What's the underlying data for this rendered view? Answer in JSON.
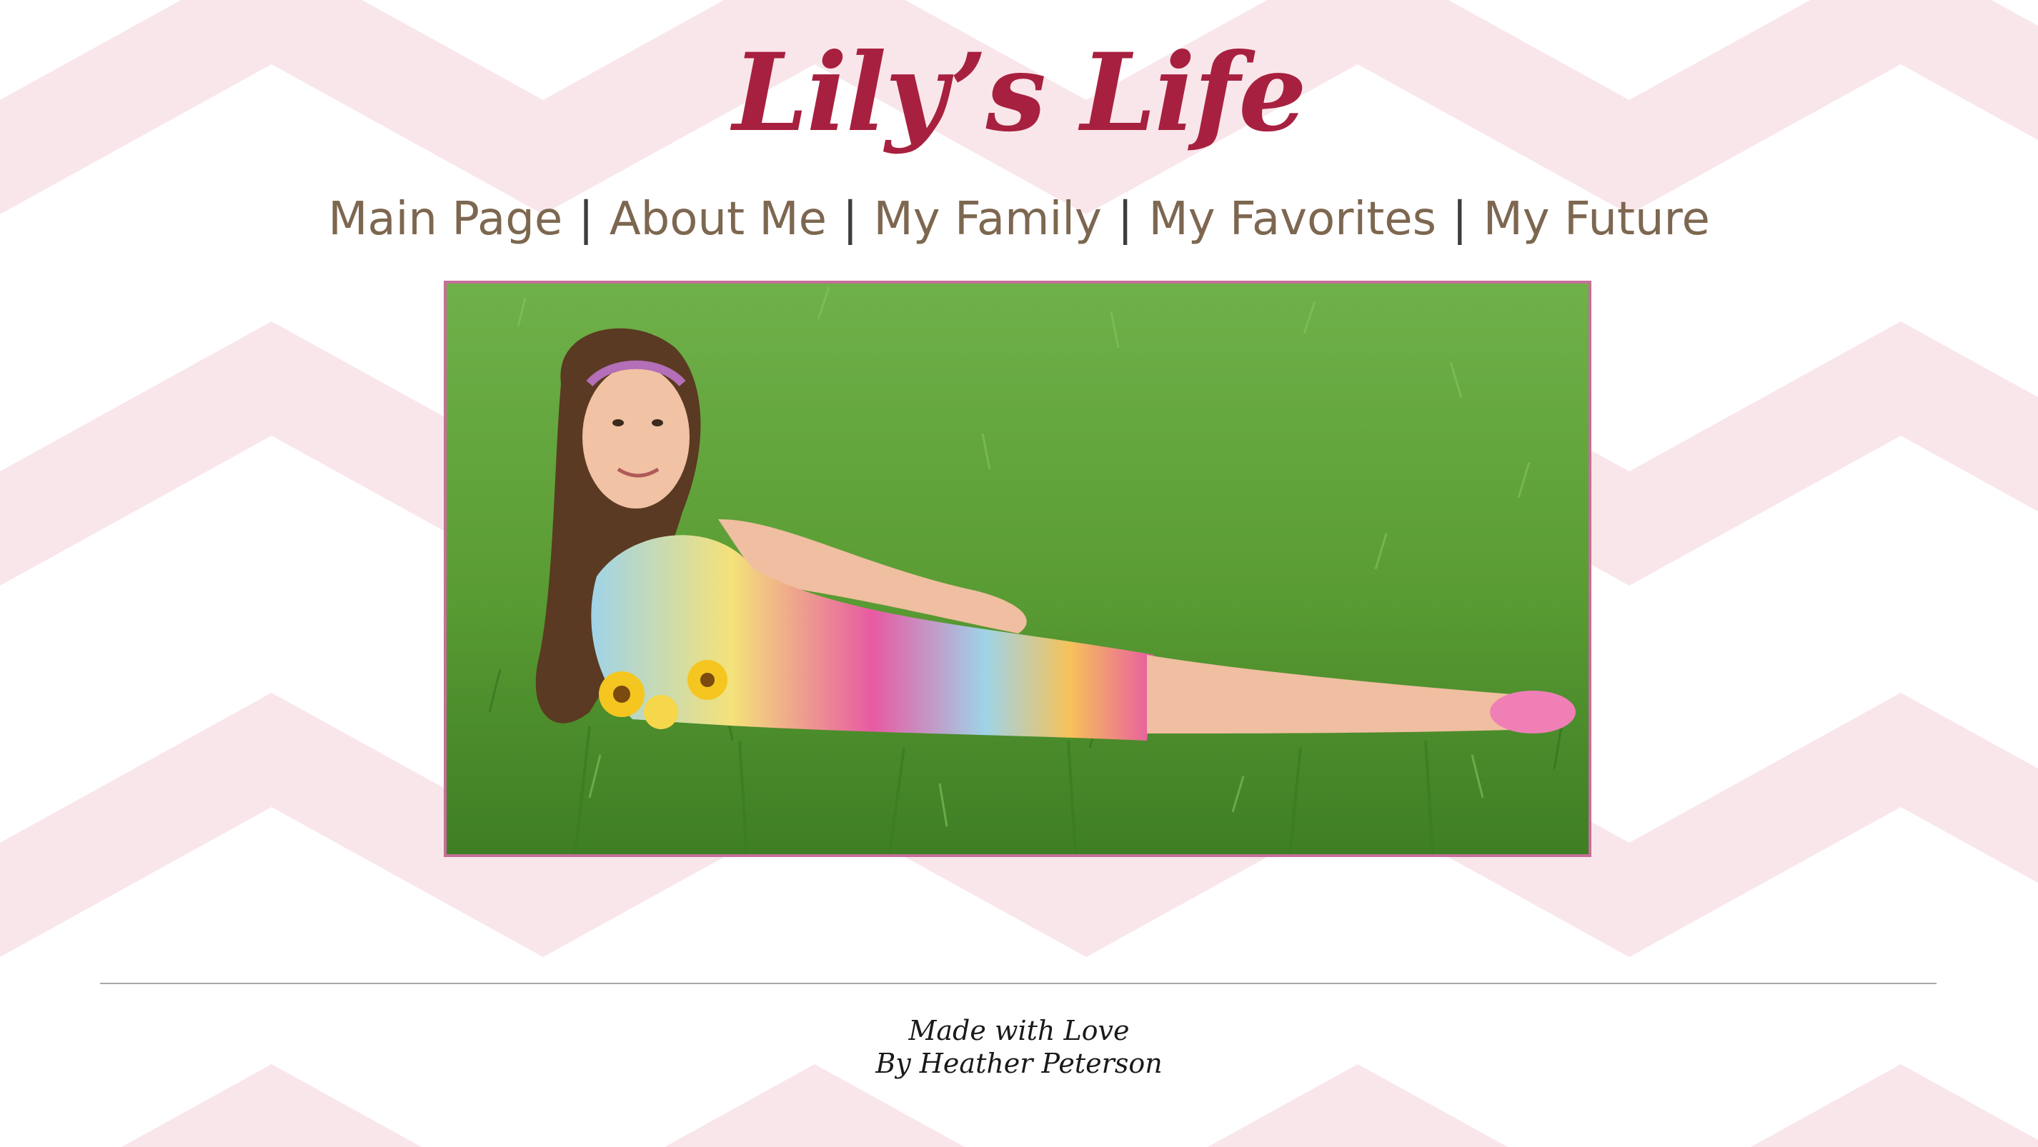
{
  "site": {
    "title": "Lily’s Life"
  },
  "nav": {
    "items": [
      {
        "label": "Main Page"
      },
      {
        "label": "About Me"
      },
      {
        "label": "My Family"
      },
      {
        "label": "My Favorites"
      },
      {
        "label": "My Future"
      }
    ],
    "separator": "|"
  },
  "hero": {
    "image_name": "girl-lying-in-grass-photo"
  },
  "footer": {
    "line1": "Made with Love",
    "line2": "By Heather Peterson"
  },
  "colors": {
    "title": "#a8203f",
    "nav_text": "#7d6750",
    "chevron_pink": "#f9e6ea",
    "frame_border": "#c56f98",
    "rule": "#a9a9a9"
  }
}
